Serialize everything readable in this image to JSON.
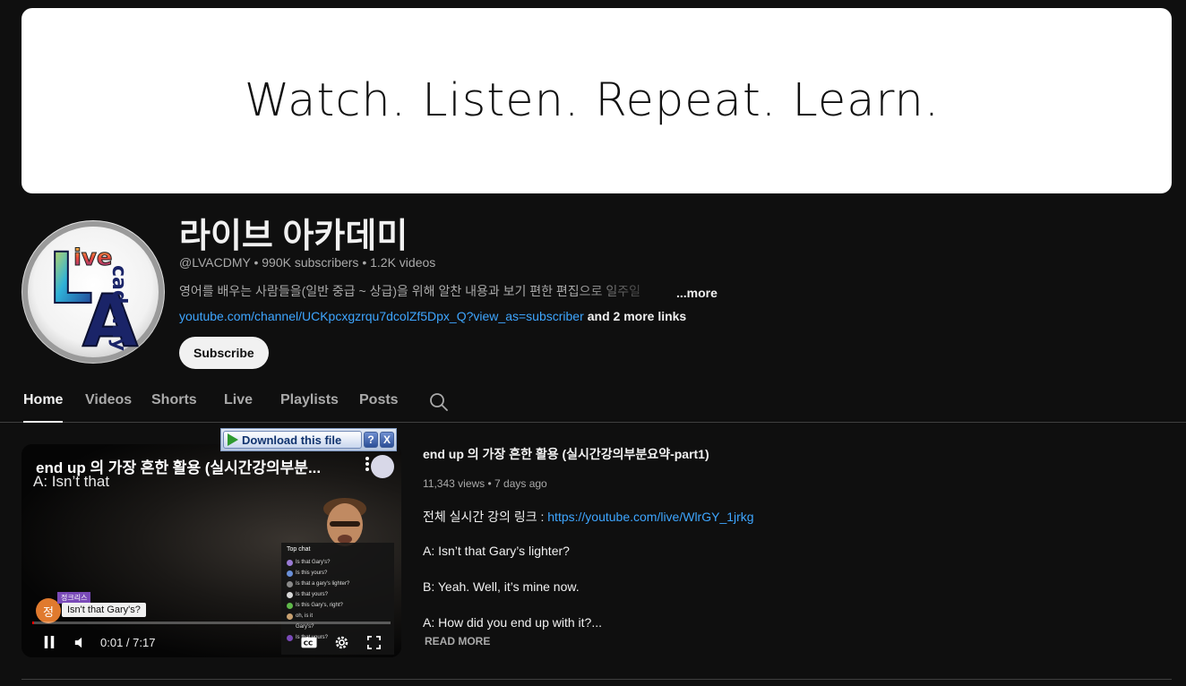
{
  "banner": {
    "text": "Watch. Listen. Repeat. Learn."
  },
  "channel": {
    "title": "라이브 아카데미",
    "handle": "@LVACDMY",
    "stats": "• 990K subscribers • 1.2K videos",
    "description": "영어를 배우는 사람들을(일반 중급 ~ 상급)을 위해 알찬 내용과 보기 편한 편집으로 일주일",
    "more_label": "...more",
    "link": "youtube.com/channel/UCKpcxgzrqu7dcolZf5Dpx_Q?view_as=subscriber",
    "extra_links": "and 2 more links",
    "subscribe_label": "Subscribe",
    "avatar_icon": "live-academy-logo"
  },
  "tabs": [
    {
      "label": "Home",
      "active": true
    },
    {
      "label": "Videos"
    },
    {
      "label": "Shorts"
    },
    {
      "label": "Live"
    },
    {
      "label": "Playlists"
    },
    {
      "label": "Posts"
    }
  ],
  "search_icon": "search-icon",
  "player": {
    "title": "end up 의 가장 흔한 활용 (실시간강의부분...",
    "subtitle": "A: Isn’t that",
    "chat_header": "Top chat",
    "chat_lines": [
      "Is that Gary's?",
      "Is this yours?",
      "Is that a gary's lighter?",
      "Is that yours?",
      "Is this Gary's, right?",
      "oh, is it",
      "Gary's?",
      "Is that yours?"
    ],
    "caption_tag": "정크리스",
    "caption_text": "Isn't that Gary's?",
    "caption_avatar": "정",
    "time": "0:01 / 7:17",
    "progress": 0.004
  },
  "download_bar": {
    "label": "Download this file",
    "help": "?",
    "close": "X"
  },
  "video": {
    "title": "end up 의 가장 흔한 활용 (실시간강의부분요약-part1)",
    "meta": "11,343 views • 7 days ago",
    "desc_prefix": "전체 실시간 강의 링크 : ",
    "desc_link": "https://youtube.com/live/WlrGY_1jrkg",
    "lines": [
      "A: Isn’t that Gary’s lighter?",
      "B: Yeah. Well, it’s mine now.",
      "A: How did you end up with it?..."
    ],
    "read_more": "READ MORE"
  }
}
